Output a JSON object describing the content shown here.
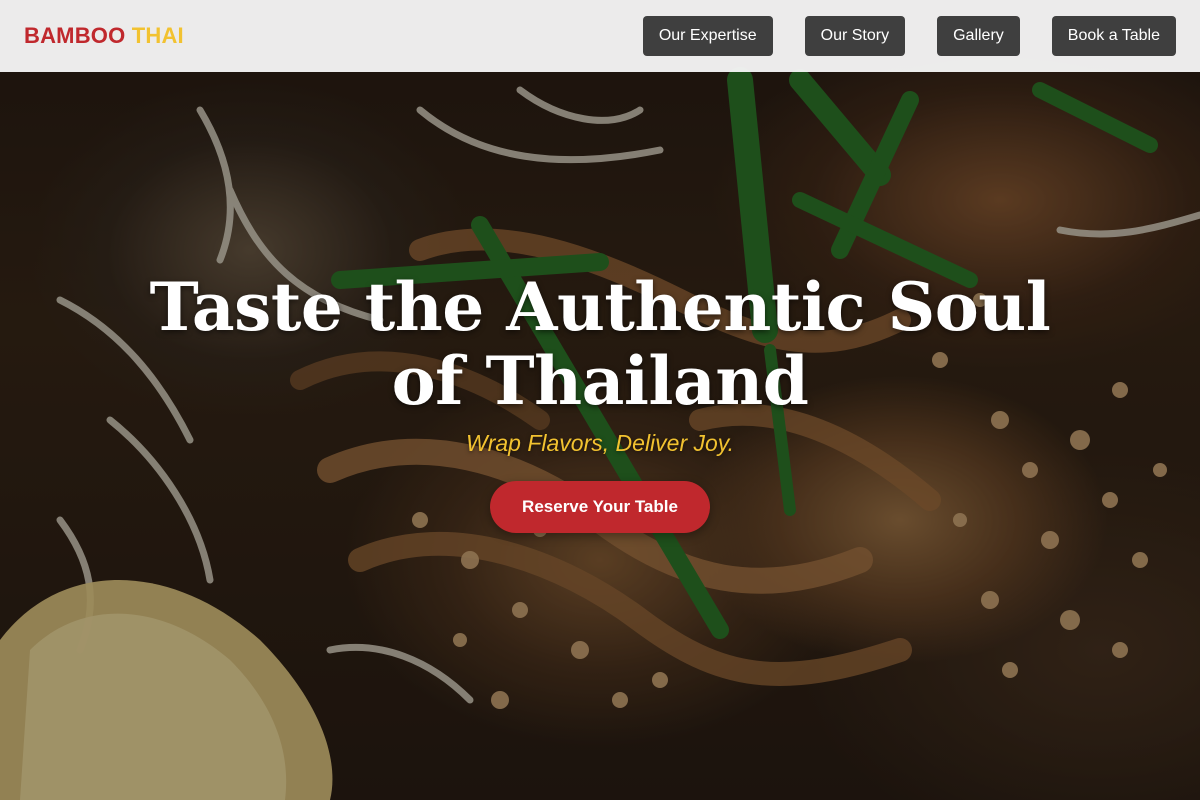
{
  "header": {
    "brand_part1": "BAMBOO",
    "brand_part2": "THAI",
    "nav": [
      {
        "label": "Our Expertise"
      },
      {
        "label": "Our Story"
      },
      {
        "label": "Gallery"
      },
      {
        "label": "Book a Table"
      }
    ]
  },
  "hero": {
    "title": "Taste the Authentic Soul of Thailand",
    "tagline": "Wrap Flavors, Deliver Joy.",
    "cta_label": "Reserve Your Table",
    "image_subject": "pad thai noodles with bean sprouts, chives, crushed peanuts and lemon wedge"
  },
  "colors": {
    "brand_red": "#c0282d",
    "brand_yellow": "#f2c230",
    "nav_button_bg": "#3f3f3f",
    "navbar_bg": "#f5f5f5"
  }
}
